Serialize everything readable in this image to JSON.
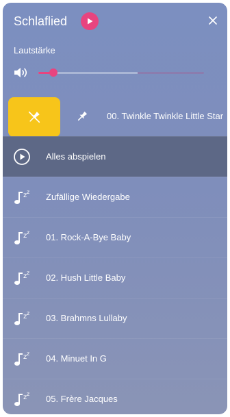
{
  "header": {
    "title": "Schlaflied",
    "play_icon": "play-icon",
    "close_icon": "close-icon"
  },
  "volume": {
    "label": "Lautstärke",
    "level_percent": 9,
    "buffered_percent": 60,
    "icon": "speaker-icon"
  },
  "pinned": {
    "label": "00. Twinkle Twinkle Little Star",
    "action_icon": "unpin-icon",
    "row_icon": "pin-icon"
  },
  "list": {
    "items": [
      {
        "label": "Alles abspielen",
        "icon": "play-circle-icon",
        "active": true
      },
      {
        "label": "Zufällige Wiedergabe",
        "icon": "sleep-music-icon",
        "active": false
      },
      {
        "label": "01. Rock-A-Bye Baby",
        "icon": "sleep-music-icon",
        "active": false
      },
      {
        "label": "02. Hush Little Baby",
        "icon": "sleep-music-icon",
        "active": false
      },
      {
        "label": "03. Brahmns Lullaby",
        "icon": "sleep-music-icon",
        "active": false
      },
      {
        "label": "04. Minuet In G",
        "icon": "sleep-music-icon",
        "active": false
      },
      {
        "label": "05. Frère Jacques",
        "icon": "sleep-music-icon",
        "active": false
      }
    ]
  },
  "colors": {
    "accent": "#e8447f",
    "pin_action": "#f7c51a",
    "active_row": "#5d6886",
    "text": "#ffffff"
  }
}
